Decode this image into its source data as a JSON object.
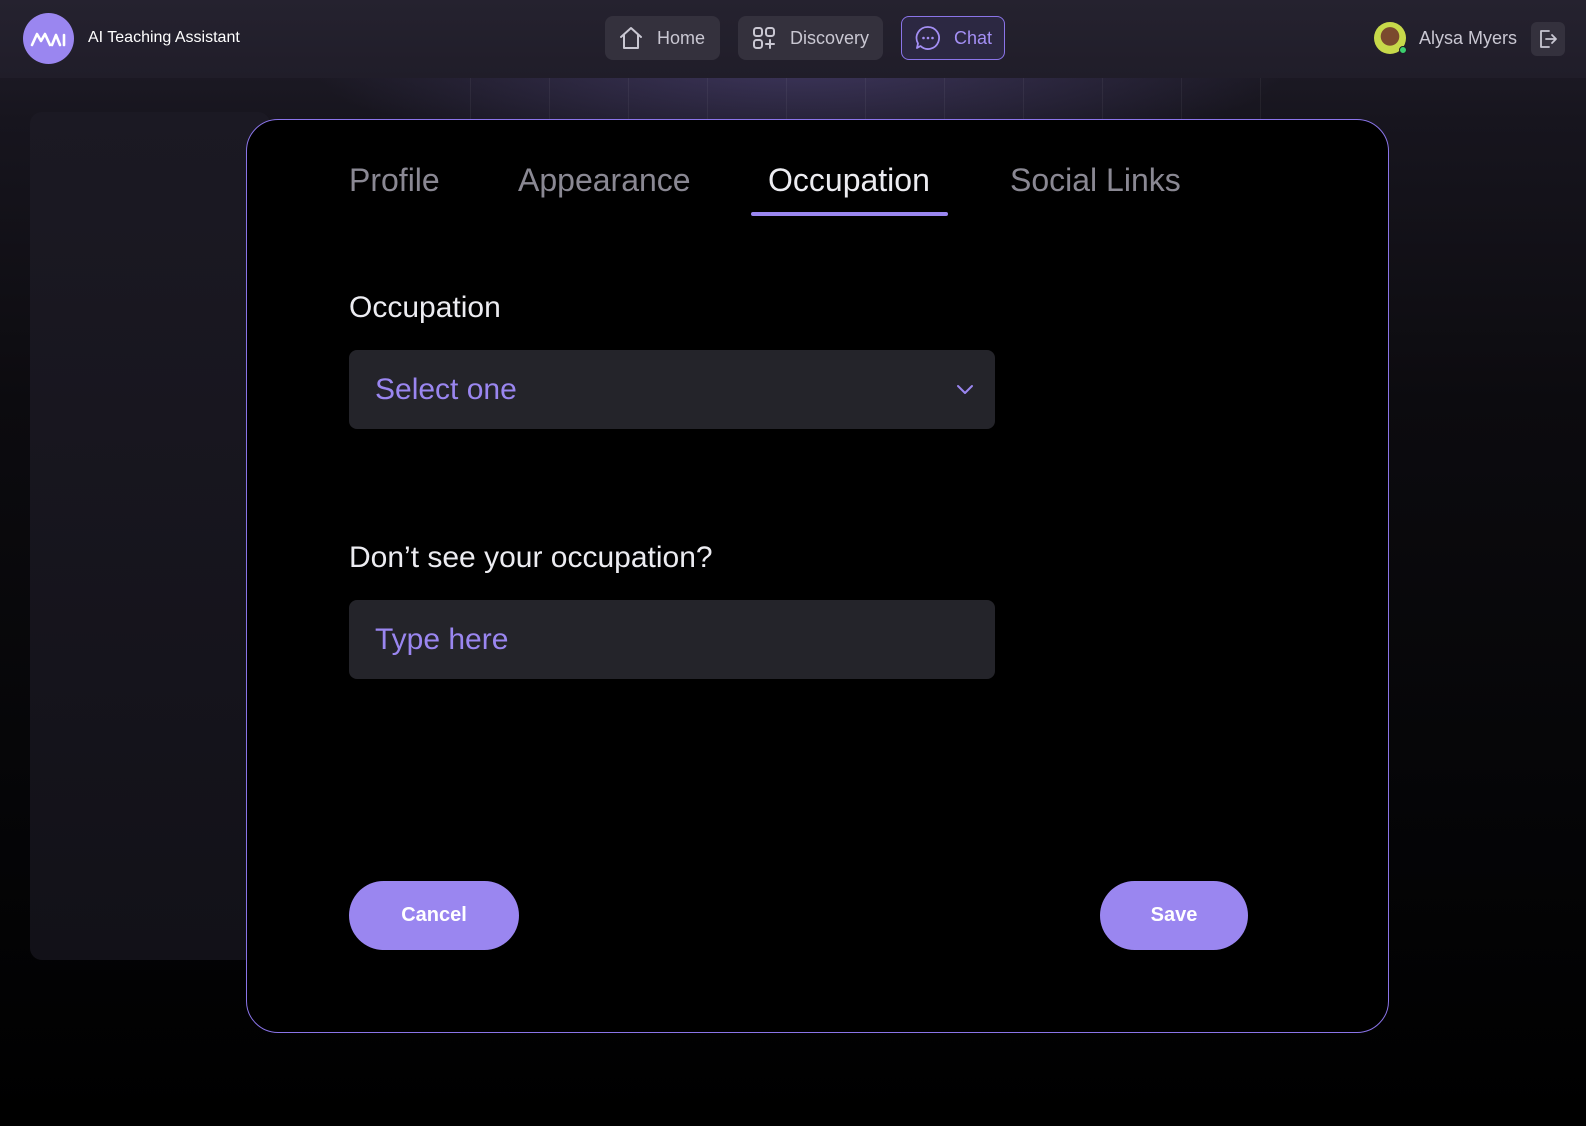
{
  "app": {
    "logo_text": "MAI",
    "title": "AI Teaching Assistant"
  },
  "nav": {
    "items": [
      {
        "label": "Home",
        "icon": "home-icon"
      },
      {
        "label": "Discovery",
        "icon": "grid-plus-icon"
      },
      {
        "label": "Chat",
        "icon": "chat-bubble-icon",
        "active": true
      }
    ]
  },
  "user": {
    "name": "Alysa Myers",
    "status": "online"
  },
  "settings": {
    "tabs": [
      {
        "label": "Profile"
      },
      {
        "label": "Appearance"
      },
      {
        "label": "Occupation",
        "active": true
      },
      {
        "label": "Social Links"
      }
    ],
    "occupation_label": "Occupation",
    "occupation_select_placeholder": "Select one",
    "custom_label": "Don’t see your occupation?",
    "custom_placeholder": "Type here",
    "cancel_label": "Cancel",
    "save_label": "Save"
  },
  "colors": {
    "accent": "#9a86f0",
    "modal_border": "#8a74e8",
    "field_bg": "#24242a",
    "online": "#3ccf6e"
  }
}
